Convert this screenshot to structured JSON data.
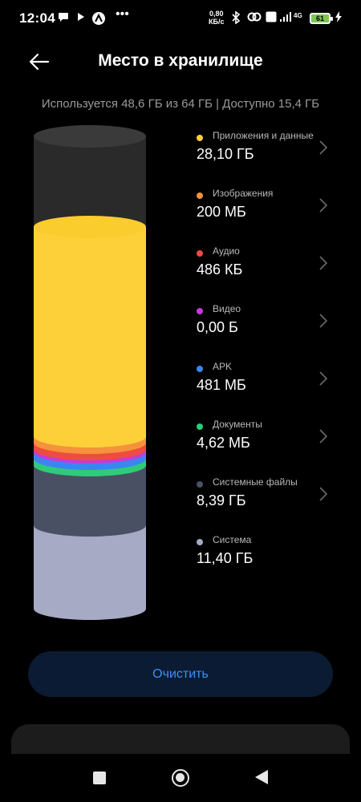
{
  "status_bar": {
    "time": "12:04",
    "net_speed_value": "0,80",
    "net_speed_unit": "КБ/с",
    "network_type": "4G",
    "battery_level": "61"
  },
  "header": {
    "title": "Место в хранилище"
  },
  "summary": "Используется 48,6 ГБ из 64 ГБ | Доступно 15,4 ГБ",
  "categories": [
    {
      "name": "Приложения и данные",
      "size": "28,10 ГБ",
      "color": "#fdd03a",
      "has_chevron": true
    },
    {
      "name": "Изображения",
      "size": "200 МБ",
      "color": "#f5923b",
      "has_chevron": true
    },
    {
      "name": "Аудио",
      "size": "486 КБ",
      "color": "#ee4b43",
      "has_chevron": true
    },
    {
      "name": "Видео",
      "size": "0,00 Б",
      "color": "#c43bd6",
      "has_chevron": true
    },
    {
      "name": "APK",
      "size": "481 МБ",
      "color": "#3a86f0",
      "has_chevron": true
    },
    {
      "name": "Документы",
      "size": "4,62 МБ",
      "color": "#2fcb78",
      "has_chevron": true
    },
    {
      "name": "Системные файлы",
      "size": "8,39 ГБ",
      "color": "#4a5064",
      "has_chevron": true
    },
    {
      "name": "Система",
      "size": "11,40 ГБ",
      "color": "#a6aac4",
      "has_chevron": false
    }
  ],
  "clean_button": {
    "label": "Очистить"
  },
  "colors": {
    "free_space": "#2a2a2a",
    "accent": "#3d8ff2",
    "button_bg": "#0b1b33"
  }
}
